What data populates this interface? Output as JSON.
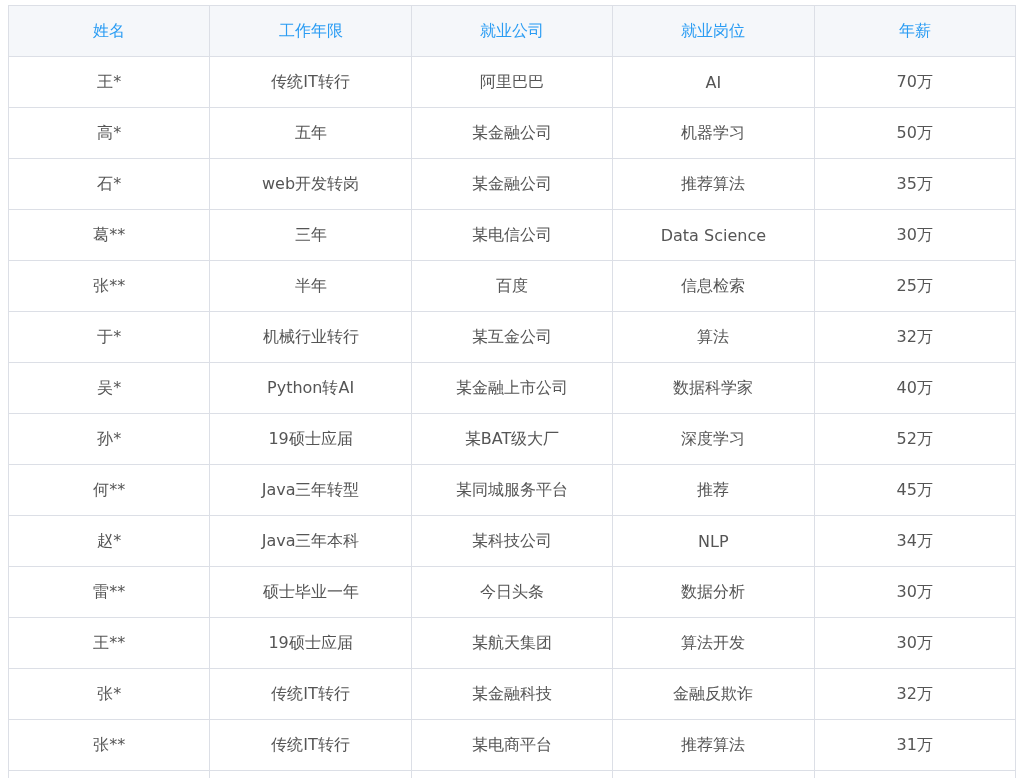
{
  "table": {
    "columns": [
      "姓名",
      "工作年限",
      "就业公司",
      "就业岗位",
      "年薪"
    ],
    "rows": [
      [
        "王*",
        "传统IT转行",
        "阿里巴巴",
        "AI",
        "70万"
      ],
      [
        "高*",
        "五年",
        "某金融公司",
        "机器学习",
        "50万"
      ],
      [
        "石*",
        "web开发转岗",
        "某金融公司",
        "推荐算法",
        "35万"
      ],
      [
        "葛**",
        "三年",
        "某电信公司",
        "Data Science",
        "30万"
      ],
      [
        "张**",
        "半年",
        "百度",
        "信息检索",
        "25万"
      ],
      [
        "于*",
        "机械行业转行",
        "某互金公司",
        "算法",
        "32万"
      ],
      [
        "吴*",
        "Python转AI",
        "某金融上市公司",
        "数据科学家",
        "40万"
      ],
      [
        "孙*",
        "19硕士应届",
        "某BAT级大厂",
        "深度学习",
        "52万"
      ],
      [
        "何**",
        "Java三年转型",
        "某同城服务平台",
        "推荐",
        "45万"
      ],
      [
        "赵*",
        "Java三年本科",
        "某科技公司",
        "NLP",
        "34万"
      ],
      [
        "雷**",
        "硕士毕业一年",
        "今日头条",
        "数据分析",
        "30万"
      ],
      [
        "王**",
        "19硕士应届",
        "某航天集团",
        "算法开发",
        "30万"
      ],
      [
        "张*",
        "传统IT转行",
        "某金融科技",
        "金融反欺诈",
        "32万"
      ],
      [
        "张**",
        "传统IT转行",
        "某电商平台",
        "推荐算法",
        "31万"
      ]
    ]
  }
}
